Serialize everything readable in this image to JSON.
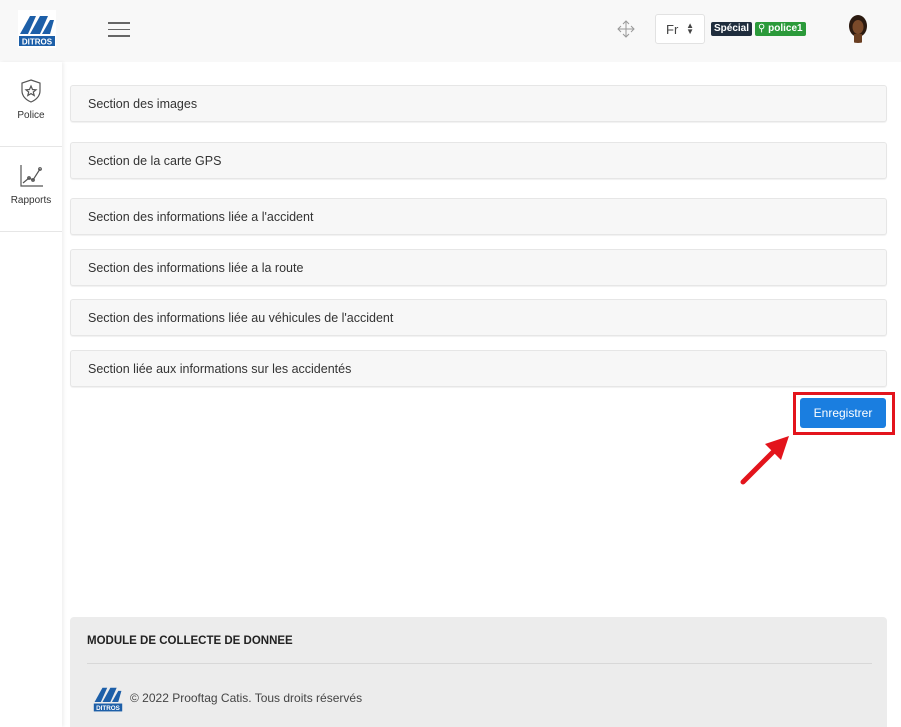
{
  "header": {
    "logo_text": "DITROS",
    "language": "Fr",
    "badge_special": "Spécial",
    "badge_user": "police1"
  },
  "sidebar": {
    "items": [
      {
        "label": "Police",
        "icon": "shield-star-icon"
      },
      {
        "label": "Rapports",
        "icon": "line-chart-icon"
      }
    ]
  },
  "sections": [
    "Section des images",
    "Section de la carte GPS",
    "Section des informations liée a l'accident",
    "Section des informations liée a la route",
    "Section des informations liée au véhicules de l'accident",
    "Section liée aux informations sur les accidentés"
  ],
  "actions": {
    "save_label": "Enregistrer"
  },
  "footer": {
    "title": "MODULE DE COLLECTE DE DONNEE",
    "copyright": "© 2022 Prooftag Catis. Tous droits réservés"
  },
  "colors": {
    "primary": "#1a7ee0",
    "highlight": "#e3141c",
    "badge_special": "#1f2d3d",
    "badge_user": "#2b9a3a"
  }
}
